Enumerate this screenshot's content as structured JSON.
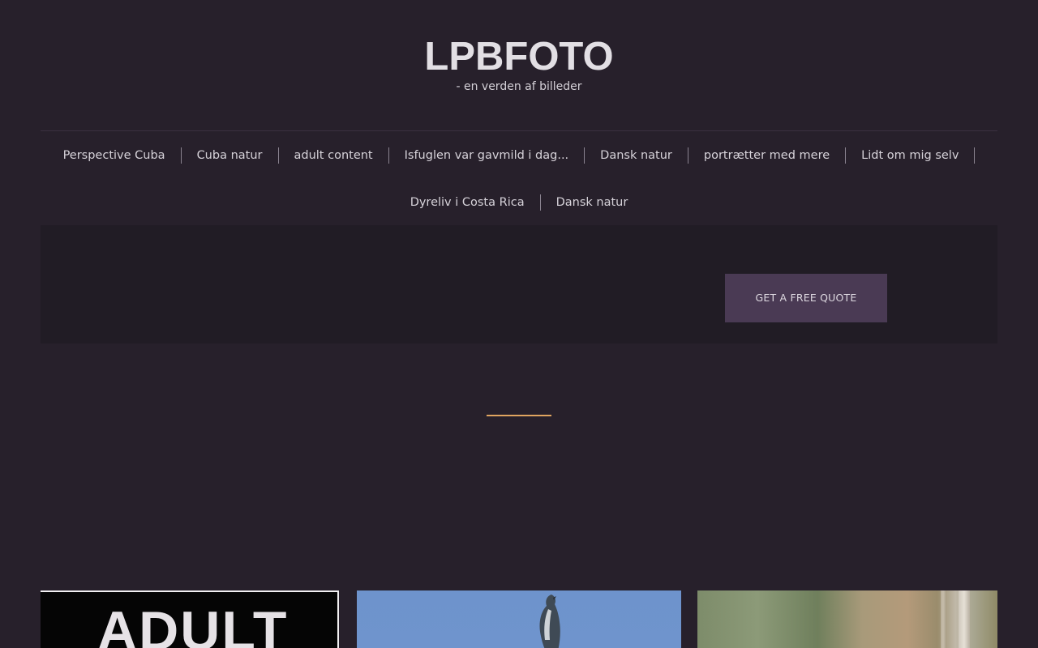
{
  "site": {
    "title": "LPBFOTO",
    "tagline": "- en verden af billeder"
  },
  "nav": {
    "row1": [
      "Perspective Cuba",
      "Cuba natur",
      "adult content",
      "Isfuglen var gavmild i dag...",
      "Dansk natur",
      "portrætter med mere",
      "Lidt om mig selv"
    ],
    "row2": [
      "Dyreliv i Costa Rica",
      "Dansk natur"
    ]
  },
  "hero": {
    "cta_label": "GET A FREE QUOTE"
  },
  "thumbnails": [
    {
      "name": "adult-thumbnail",
      "text": "ADULT"
    },
    {
      "name": "bird-thumbnail",
      "text": ""
    },
    {
      "name": "reeds-thumbnail",
      "text": ""
    }
  ],
  "colors": {
    "background": "#27202b",
    "hero_background": "#211c25",
    "cta_background": "#4a3a54",
    "accent": "#e0a560"
  }
}
